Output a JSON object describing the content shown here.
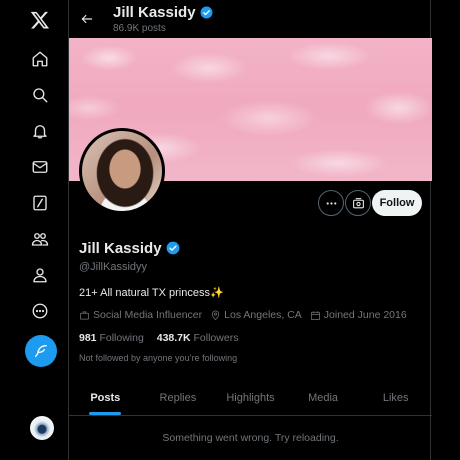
{
  "nav": {
    "items": [
      "x-logo-icon",
      "home-icon",
      "explore-icon",
      "notifications-icon",
      "messages-icon",
      "grok-icon",
      "communities-icon",
      "profile-icon",
      "more-icon"
    ],
    "post_icon": "feather-icon"
  },
  "header": {
    "name": "Jill Kassidy",
    "posts_count": "86.9K posts"
  },
  "profile": {
    "name": "Jill Kassidy",
    "handle": "@JillKassidyy",
    "bio": "21+ All natural TX princess✨",
    "category": "Social Media Influencer",
    "location": "Los Angeles, CA",
    "joined": "Joined June 2016",
    "following_count": "981",
    "following_label": "Following",
    "followers_count": "438.7K",
    "followers_label": "Followers",
    "mutuals": "Not followed by anyone you’re following",
    "follow_label": "Follow",
    "verified_color": "#1d9bf0"
  },
  "tabs": [
    "Posts",
    "Replies",
    "Highlights",
    "Media",
    "Likes"
  ],
  "active_tab": "Posts",
  "error_message": "Something went wrong. Try reloading.",
  "colors": {
    "accent": "#1d9bf0",
    "banner": "#f2b0c4",
    "background": "#000000"
  }
}
